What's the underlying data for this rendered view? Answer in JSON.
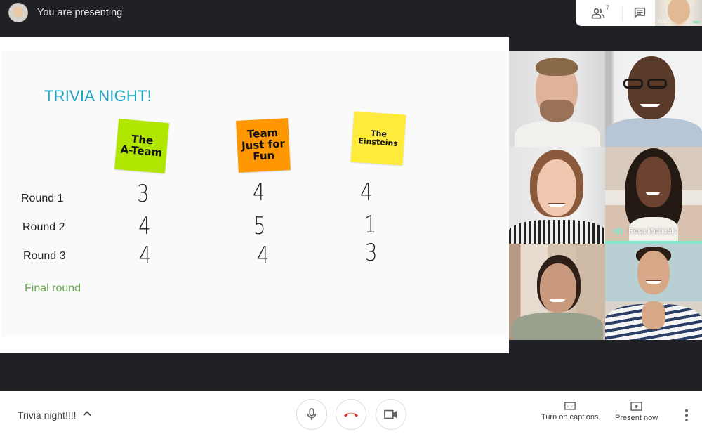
{
  "topbar": {
    "status_text": "You are presenting",
    "participants_count": "7",
    "self_tile_label": "You"
  },
  "slide": {
    "title": "TRIVIA NIGHT!",
    "teams": [
      {
        "name_line1": "The",
        "name_line2": "A-Team",
        "name_line3": "",
        "color": "#b1e600"
      },
      {
        "name_line1": "Team",
        "name_line2": "Just for",
        "name_line3": "Fun",
        "color": "#ff9800"
      },
      {
        "name_line1": "The",
        "name_line2": "Einsteins",
        "name_line3": "",
        "color": "#ffeb3b"
      }
    ],
    "rounds": [
      {
        "label": "Round 1",
        "scores": [
          "3",
          "4",
          "4"
        ]
      },
      {
        "label": "Round 2",
        "scores": [
          "4",
          "5",
          "1"
        ]
      },
      {
        "label": "Round 3",
        "scores": [
          "4",
          "4",
          "3"
        ]
      }
    ],
    "final_round_label": "Final round",
    "title_color": "#1fa4c4",
    "final_round_color": "#6aa84f"
  },
  "participants": [
    {
      "name": "",
      "speaking": false
    },
    {
      "name": "",
      "speaking": false
    },
    {
      "name": "",
      "speaking": false
    },
    {
      "name": "Rosa Michaels",
      "speaking": true
    },
    {
      "name": "",
      "speaking": false
    },
    {
      "name": "",
      "speaking": false
    }
  ],
  "bottombar": {
    "meeting_title": "Trivia night!!!!",
    "captions_label": "Turn on captions",
    "present_label": "Present now"
  },
  "icons": {
    "people": "people-icon",
    "chat": "chat-icon",
    "mic": "microphone-icon",
    "hangup": "hang-up-icon",
    "camera": "camera-icon",
    "captions": "closed-captions-icon",
    "present": "present-screen-icon",
    "more": "more-vert-icon",
    "chevron": "chevron-up-icon"
  },
  "colors": {
    "background": "#202124",
    "speaking_accent": "#80e8cc",
    "hangup_red": "#d93025"
  }
}
